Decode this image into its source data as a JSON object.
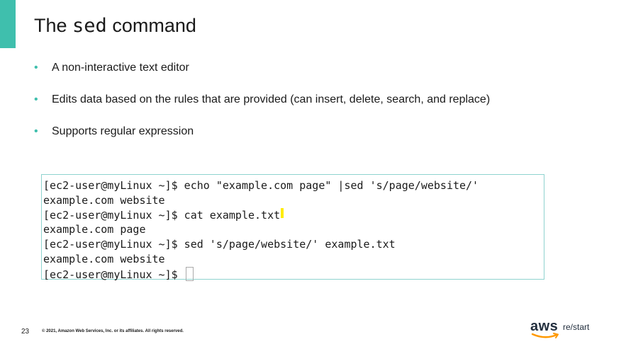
{
  "slide": {
    "title_prefix": "The ",
    "title_code": "sed",
    "title_suffix": " command",
    "bullets": [
      "A non-interactive text editor",
      "Edits data based on the rules that are provided (can insert, delete, search, and replace)",
      "Supports regular expression"
    ],
    "bullet_symbol": "•"
  },
  "terminal": {
    "lines": [
      "[ec2-user@myLinux ~]$ echo \"example.com page\" |sed 's/page/website/'",
      "example.com website",
      "[ec2-user@myLinux ~]$ cat example.txt",
      "example.com page",
      "[ec2-user@myLinux ~]$ sed 's/page/website/' example.txt",
      "example.com website",
      "[ec2-user@myLinux ~]$ "
    ]
  },
  "footer": {
    "slide_number": "23",
    "copyright": "© 2021, Amazon Web Services, Inc. or its affiliates. All rights reserved.",
    "logo_aws": "aws",
    "logo_restart": "re/start"
  },
  "colors": {
    "accent": "#3fbfad",
    "terminal_border": "#8fd3cf",
    "highlight": "#ffec00",
    "aws_smile": "#ff9900"
  }
}
